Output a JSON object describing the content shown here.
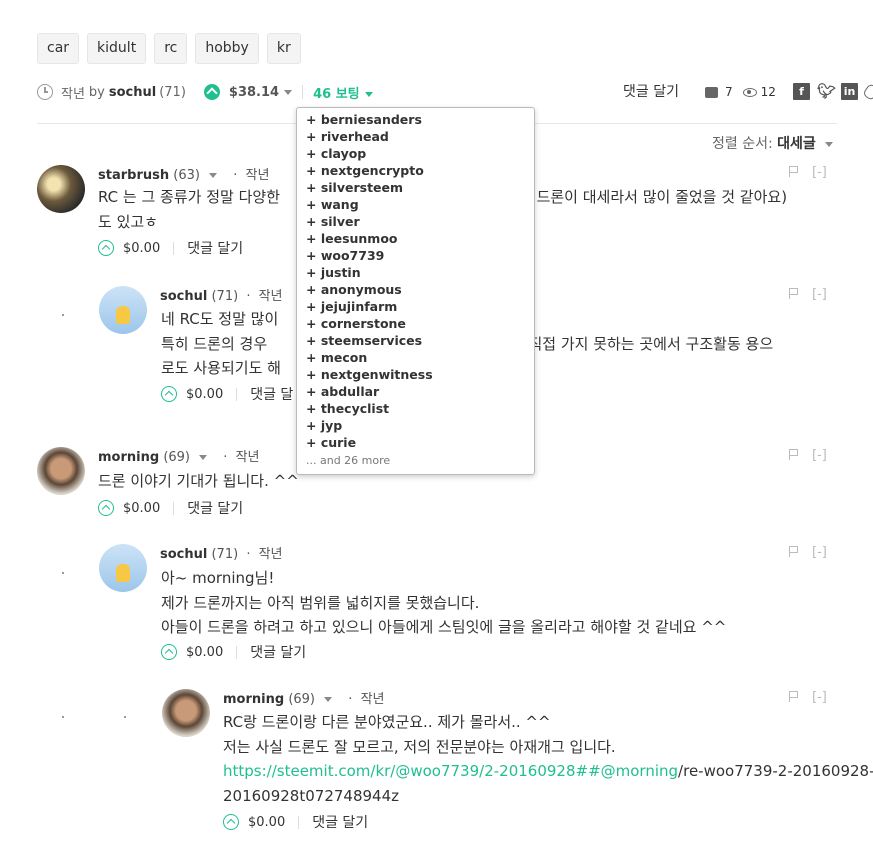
{
  "tags": [
    "car",
    "kidult",
    "rc",
    "hobby",
    "kr"
  ],
  "post": {
    "time": "작년",
    "by": "by",
    "author": "sochul",
    "reputation": "(71)",
    "payout": "$38.14",
    "votes": "46 보팅",
    "reply": "댓글 달기",
    "comment_count": "7",
    "view_count": "12",
    "share_icons": [
      "facebook-icon",
      "twitter-icon",
      "linkedin-icon",
      "link-icon"
    ]
  },
  "sort": {
    "label": "정렬 순서:",
    "value": "대세글"
  },
  "voters": {
    "items": [
      "+ berniesanders",
      "+ riverhead",
      "+ clayop",
      "+ nextgencrypto",
      "+ silversteem",
      "+ wang",
      "+ silver",
      "+ leesunmoo",
      "+ woo7739",
      "+ justin",
      "+ anonymous",
      "+ jejujinfarm",
      "+ cornerstone",
      "+ steemservices",
      "+ mecon",
      "+ nextgenwitness",
      "+ abdullar",
      "+ thecyclist",
      "+ jyp",
      "+ curie"
    ],
    "more": "... and 26 more"
  },
  "comments": [
    {
      "author": "starbrush",
      "rep": "(63)",
      "time": "작년",
      "lines": [
        "RC 는 그 종류가 정말 다양한",
        "은 드론이 대세라서 많이 줄었을 것 같아요)",
        "도 있고ㅎ"
      ],
      "payout": "$0.00",
      "reply": "댓글 달기",
      "flag": "[-]"
    },
    {
      "author": "sochul",
      "rep": "(71)",
      "time": "작년",
      "lines": [
        "네 RC도 정말 많이 ",
        "특히 드론의 경우 ",
        "이 직접 가지 못하는 곳에서 구조활동 용으",
        "로도 사용되기도 해"
      ],
      "payout": "$0.00",
      "reply": "댓글 달",
      "flag": "[-]"
    },
    {
      "author": "morning",
      "rep": "(69)",
      "time": "작년",
      "lines": [
        "드론 이야기 기대가 됩니다. ^^"
      ],
      "payout": "$0.00",
      "reply": "댓글 달기",
      "flag": "[-]"
    },
    {
      "author": "sochul",
      "rep": "(71)",
      "time": "작년",
      "lines": [
        "아~ morning님!",
        "제가 드론까지는 아직 범위를 넓히지를 못했습니다.",
        "아들이 드론을 하려고 하고 있으니 아들에게 스팀잇에 글을 올리라고 해야할 것 같네요 ^^"
      ],
      "payout": "$0.00",
      "reply": "댓글 달기",
      "flag": "[-]"
    },
    {
      "author": "morning",
      "rep": "(69)",
      "time": "작년",
      "lines": [
        "RC랑 드론이랑 다른 분야였군요.. 제가 몰라서.. ^^",
        "저는 사실 드론도 잘 모르고, 저의 전문분야는 아재개그 입니다."
      ],
      "link": "https://steemit.com/kr/@woo7739/2-20160928##@morning",
      "link_tail": "/re-woo7739-2-20160928-",
      "last_line": "20160928t072748944z",
      "payout": "$0.00",
      "reply": "댓글 달기",
      "flag": "[-]"
    }
  ],
  "colors": {
    "accent": "#1fbf8f",
    "text": "#333333",
    "muted": "#666666"
  }
}
